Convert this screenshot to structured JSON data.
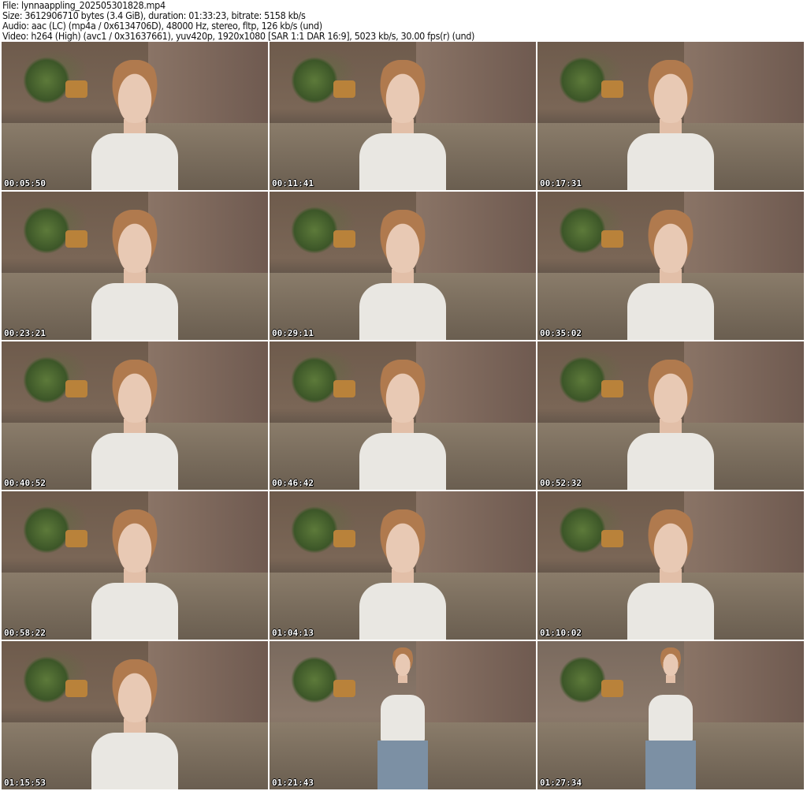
{
  "header": {
    "file": "File: lynnaappling_202505301828.mp4",
    "size": "Size: 3612906710 bytes (3.4 GiB), duration: 01:33:23, bitrate: 5158 kb/s",
    "audio": "Audio: aac (LC) (mp4a / 0x6134706D), 48000 Hz, stereo, fltp, 126 kb/s (und)",
    "video": "Video: h264 (High) (avc1 / 0x31637661), yuv420p, 1920x1080 [SAR 1:1 DAR 16:9], 5023 kb/s, 30.00 fps(r) (und)"
  },
  "thumbnails": [
    {
      "timestamp": "00:05:50"
    },
    {
      "timestamp": "00:11:41"
    },
    {
      "timestamp": "00:17:31"
    },
    {
      "timestamp": "00:23:21"
    },
    {
      "timestamp": "00:29:11"
    },
    {
      "timestamp": "00:35:02"
    },
    {
      "timestamp": "00:40:52"
    },
    {
      "timestamp": "00:46:42"
    },
    {
      "timestamp": "00:52:32"
    },
    {
      "timestamp": "00:58:22"
    },
    {
      "timestamp": "01:04:13"
    },
    {
      "timestamp": "01:10:02"
    },
    {
      "timestamp": "01:15:53"
    },
    {
      "timestamp": "01:21:43",
      "wide": true
    },
    {
      "timestamp": "01:27:34",
      "wide": true
    }
  ]
}
